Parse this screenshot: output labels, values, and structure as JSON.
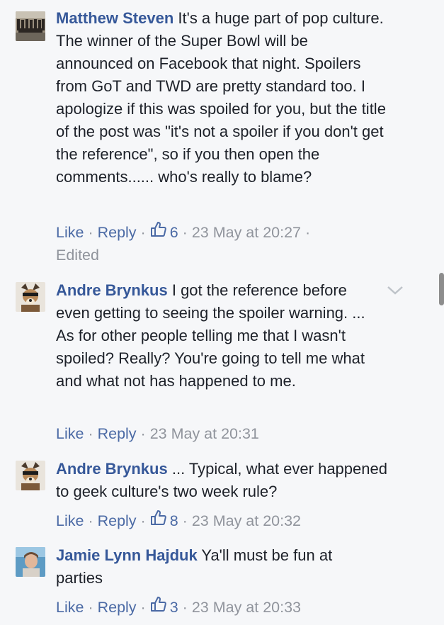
{
  "comments": [
    {
      "author": "Matthew Steven",
      "text": "It's a huge part of pop culture. The winner of the Super Bowl will be announced on Facebook that night. Spoilers from GoT and TWD are pretty standard too. I apologize if this was spoiled for you, but the title of the post was \"it's not a spoiler if you don't get the reference\", so if you then open the comments...... who's really to blame?",
      "like_label": "Like",
      "reply_label": "Reply",
      "reaction_count": "6",
      "timestamp": "23 May at 20:27",
      "edited_label": "Edited",
      "avatar_icon": "group-photo-avatar"
    },
    {
      "author": "Andre Brynkus",
      "text": "I got the reference before even getting to seeing the spoiler warning. ... As for other people telling me that I wasn't spoiled? Really? You're going to tell me what and what not has happened to me.",
      "like_label": "Like",
      "reply_label": "Reply",
      "timestamp": "23 May at 20:31",
      "avatar_icon": "dog-avatar"
    },
    {
      "author": "Andre Brynkus",
      "text": "... Typical, what ever happened to geek culture's two week rule?",
      "like_label": "Like",
      "reply_label": "Reply",
      "reaction_count": "8",
      "timestamp": "23 May at 20:32",
      "avatar_icon": "dog-avatar"
    },
    {
      "author": "Jamie Lynn Hajduk",
      "text": "Ya'll must be fun at parties",
      "like_label": "Like",
      "reply_label": "Reply",
      "reaction_count": "3",
      "timestamp": "23 May at 20:33",
      "avatar_icon": "person-avatar"
    }
  ],
  "separator": "·",
  "colors": {
    "author": "#365899",
    "link": "#4b6aa5",
    "meta": "#90949c",
    "text": "#1d2129",
    "background": "#f6f7f9"
  }
}
